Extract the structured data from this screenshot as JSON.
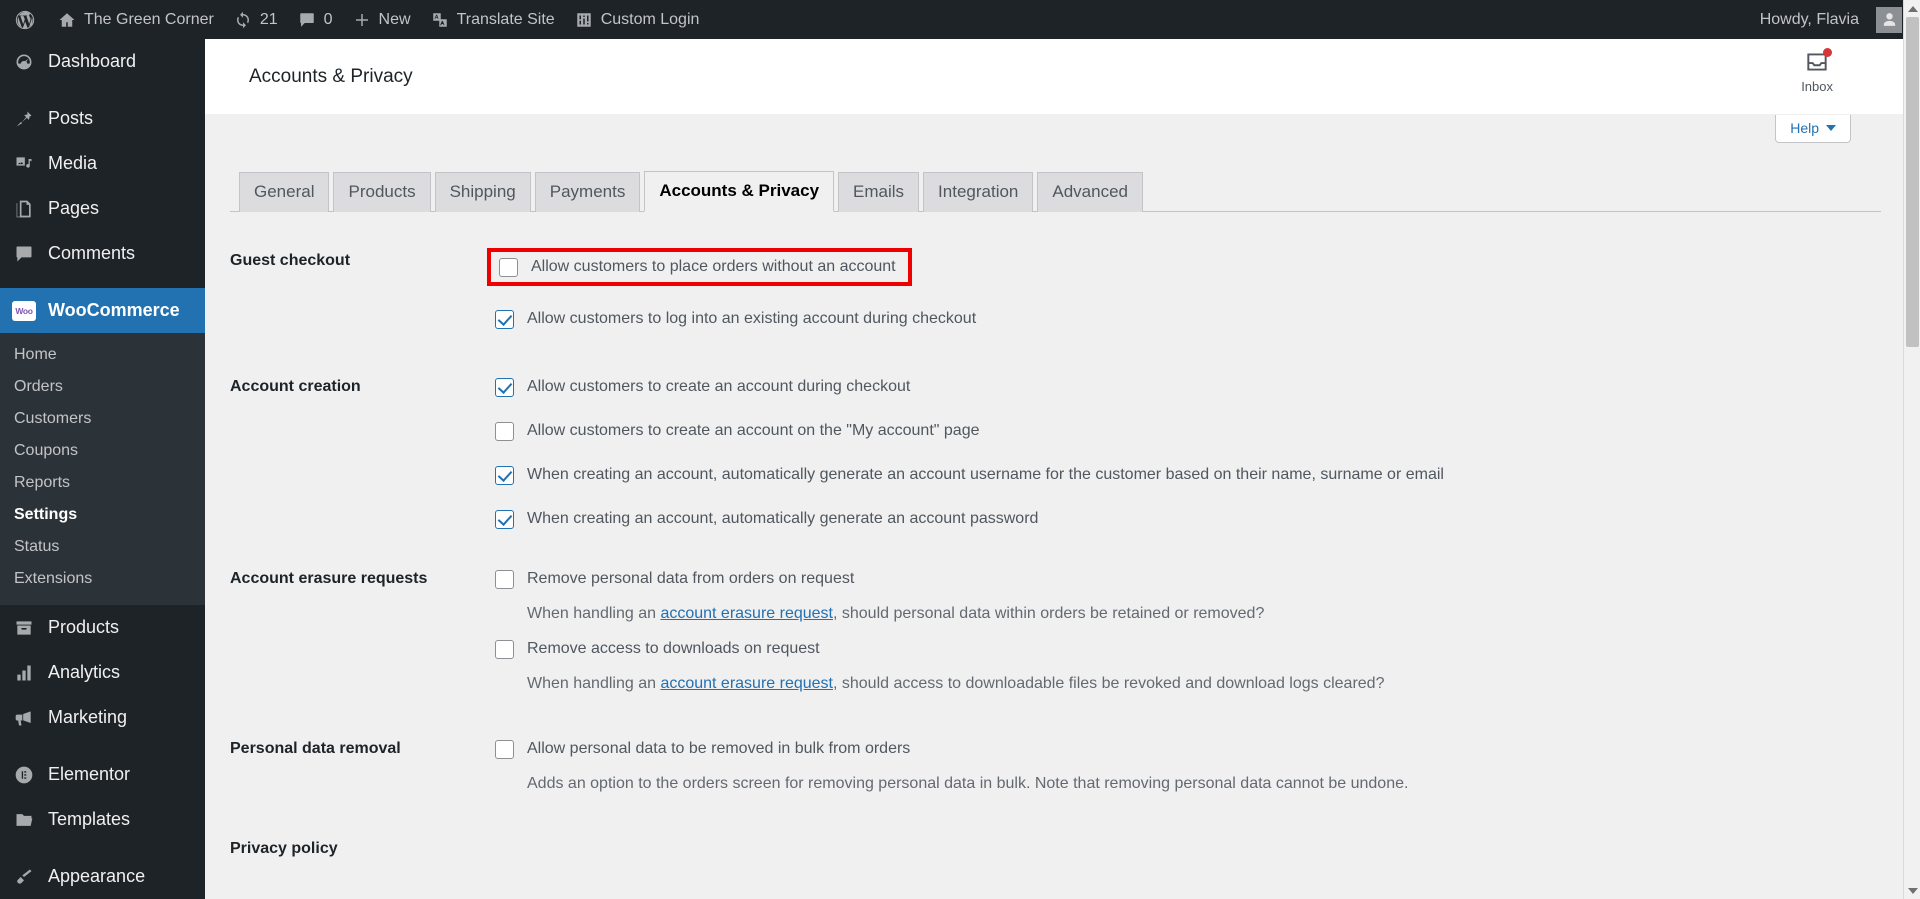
{
  "adminbar": {
    "wp_logo": "wordpress-logo-icon",
    "site_name": "The Green Corner",
    "updates_count": "21",
    "comments_count": "0",
    "new_label": "New",
    "translate_label": "Translate Site",
    "custom_login_label": "Custom Login",
    "howdy": "Howdy, Flavia"
  },
  "sidebar": {
    "items": [
      {
        "label": "Dashboard",
        "icon": "dashboard-icon"
      },
      {
        "label": "Posts",
        "icon": "pin-icon"
      },
      {
        "label": "Media",
        "icon": "media-icon"
      },
      {
        "label": "Pages",
        "icon": "pages-icon"
      },
      {
        "label": "Comments",
        "icon": "comment-icon"
      },
      {
        "label": "WooCommerce",
        "icon": "woo-icon"
      },
      {
        "label": "Products",
        "icon": "products-icon"
      },
      {
        "label": "Analytics",
        "icon": "analytics-icon"
      },
      {
        "label": "Marketing",
        "icon": "megaphone-icon"
      },
      {
        "label": "Elementor",
        "icon": "elementor-icon"
      },
      {
        "label": "Templates",
        "icon": "folder-icon"
      },
      {
        "label": "Appearance",
        "icon": "brush-icon"
      }
    ],
    "woocommerce_submenu": [
      "Home",
      "Orders",
      "Customers",
      "Coupons",
      "Reports",
      "Settings",
      "Status",
      "Extensions"
    ],
    "active_submenu": "Settings",
    "active_item": "WooCommerce"
  },
  "header": {
    "title": "Accounts & Privacy",
    "inbox_label": "Inbox",
    "help_label": "Help"
  },
  "tabs": [
    {
      "label": "General",
      "active": false
    },
    {
      "label": "Products",
      "active": false
    },
    {
      "label": "Shipping",
      "active": false
    },
    {
      "label": "Payments",
      "active": false
    },
    {
      "label": "Accounts & Privacy",
      "active": true
    },
    {
      "label": "Emails",
      "active": false
    },
    {
      "label": "Integration",
      "active": false
    },
    {
      "label": "Advanced",
      "active": false
    }
  ],
  "settings": {
    "guest_checkout": {
      "heading": "Guest checkout",
      "opt_place_orders": "Allow customers to place orders without an account",
      "opt_place_orders_checked": false,
      "opt_log_in": "Allow customers to log into an existing account during checkout",
      "opt_log_in_checked": true
    },
    "account_creation": {
      "heading": "Account creation",
      "opt_during_checkout": "Allow customers to create an account during checkout",
      "opt_during_checkout_checked": true,
      "opt_my_account_page": "Allow customers to create an account on the \"My account\" page",
      "opt_my_account_page_checked": false,
      "opt_generate_username": "When creating an account, automatically generate an account username for the customer based on their name, surname or email",
      "opt_generate_username_checked": true,
      "opt_generate_password": "When creating an account, automatically generate an account password",
      "opt_generate_password_checked": true
    },
    "account_erasure": {
      "heading": "Account erasure requests",
      "opt_remove_personal_data": "Remove personal data from orders on request",
      "opt_remove_personal_data_checked": false,
      "desc1_before": "When handling an ",
      "desc1_link": "account erasure request",
      "desc1_after": ", should personal data within orders be retained or removed?",
      "opt_remove_downloads": "Remove access to downloads on request",
      "opt_remove_downloads_checked": false,
      "desc2_before": "When handling an ",
      "desc2_link": "account erasure request",
      "desc2_after": ", should access to downloadable files be revoked and download logs cleared?"
    },
    "personal_data_removal": {
      "heading": "Personal data removal",
      "opt_bulk_removal": "Allow personal data to be removed in bulk from orders",
      "opt_bulk_removal_checked": false,
      "desc": "Adds an option to the orders screen for removing personal data in bulk. Note that removing personal data cannot be undone."
    },
    "privacy_policy": {
      "heading": "Privacy policy"
    }
  },
  "colors": {
    "admin_dark": "#1d2327",
    "submenu_dark": "#2c3338",
    "accent_blue": "#2271b1",
    "highlight_red": "#ef0000",
    "notification_red": "#d63638",
    "content_bg": "#f0f0f1"
  }
}
